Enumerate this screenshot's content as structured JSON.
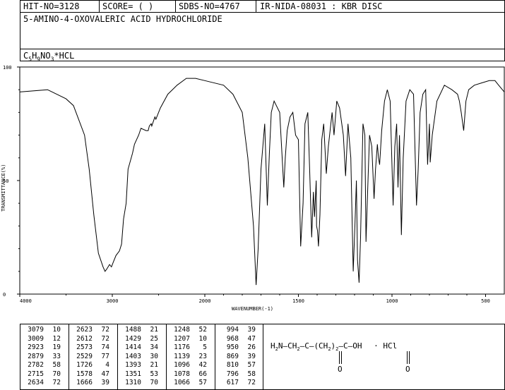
{
  "header": {
    "hit_no": "HIT-NO=3128",
    "score": "SCORE=  (   )",
    "sdbs_no": "SDBS-NO=4767",
    "ir_source": "IR-NIDA-08031 : KBR DISC",
    "compound_name": "5-AMINO-4-OXOVALERIC ACID HYDROCHLORIDE",
    "formula": "C5H9NO3*HCL"
  },
  "chart_data": {
    "type": "line",
    "xlabel": "WAVENUMBER(-1)",
    "ylabel": "TRANSMITTANCE(%)",
    "xlim": [
      4000,
      400
    ],
    "ylim": [
      0,
      100
    ],
    "x_ticks": [
      "4000",
      "3000",
      "2000",
      "1500",
      "1000",
      "500"
    ],
    "y_ticks": [
      "100",
      "50",
      "0"
    ],
    "series": [
      {
        "x": [
          4000,
          3700,
          3500,
          3420,
          3300,
          3250,
          3200,
          3150,
          3100,
          3079,
          3060,
          3030,
          3009,
          2990,
          2960,
          2923,
          2900,
          2879,
          2850,
          2830,
          2782,
          2760,
          2715,
          2690,
          2634,
          2623,
          2612,
          2600,
          2580,
          2573,
          2540,
          2529,
          2480,
          2400,
          2300,
          2200,
          2100,
          2000,
          1900,
          1850,
          1800,
          1770,
          1740,
          1726,
          1715,
          1700,
          1680,
          1666,
          1655,
          1645,
          1630,
          1600,
          1578,
          1570,
          1560,
          1545,
          1530,
          1515,
          1500,
          1488,
          1475,
          1465,
          1450,
          1440,
          1429,
          1420,
          1414,
          1405,
          1403,
          1398,
          1393,
          1385,
          1375,
          1365,
          1351,
          1340,
          1320,
          1310,
          1295,
          1280,
          1260,
          1248,
          1235,
          1220,
          1207,
          1198,
          1190,
          1184,
          1176,
          1168,
          1155,
          1145,
          1139,
          1130,
          1120,
          1108,
          1096,
          1088,
          1078,
          1072,
          1066,
          1055,
          1040,
          1025,
          1010,
          994,
          985,
          975,
          968,
          960,
          950,
          940,
          925,
          905,
          885,
          869,
          860,
          850,
          835,
          820,
          810,
          800,
          796,
          785,
          760,
          720,
          680,
          650,
          640,
          630,
          617,
          605,
          590,
          560,
          520,
          480,
          450,
          430,
          400
        ],
        "y": [
          89,
          90,
          86,
          83,
          70,
          55,
          35,
          18,
          12,
          10,
          11,
          13,
          12,
          14,
          17,
          19,
          22,
          33,
          40,
          55,
          62,
          66,
          70,
          73,
          72,
          72,
          72,
          74,
          75,
          74,
          78,
          77,
          82,
          88,
          92,
          95,
          95,
          94,
          92,
          88,
          80,
          60,
          30,
          4,
          20,
          55,
          75,
          39,
          62,
          80,
          85,
          80,
          47,
          60,
          72,
          78,
          80,
          70,
          68,
          21,
          40,
          75,
          80,
          55,
          25,
          45,
          34,
          50,
          30,
          28,
          21,
          35,
          68,
          75,
          53,
          65,
          80,
          70,
          85,
          82,
          70,
          52,
          75,
          60,
          10,
          30,
          50,
          15,
          5,
          25,
          75,
          70,
          23,
          45,
          70,
          65,
          42,
          55,
          66,
          60,
          57,
          72,
          85,
          90,
          85,
          39,
          65,
          75,
          47,
          70,
          26,
          60,
          85,
          90,
          88,
          39,
          55,
          80,
          88,
          90,
          57,
          75,
          58,
          70,
          85,
          92,
          90,
          88,
          85,
          80,
          72,
          85,
          90,
          92,
          93,
          94,
          94,
          92,
          89
        ]
      }
    ]
  },
  "peaks_table": {
    "columns": [
      [
        [
          "3079",
          "10"
        ],
        [
          "3009",
          "12"
        ],
        [
          "2923",
          "19"
        ],
        [
          "2879",
          "33"
        ],
        [
          "2782",
          "58"
        ],
        [
          "2715",
          "70"
        ],
        [
          "2634",
          "72"
        ]
      ],
      [
        [
          "2623",
          "72"
        ],
        [
          "2612",
          "72"
        ],
        [
          "2573",
          "74"
        ],
        [
          "2529",
          "77"
        ],
        [
          "1726",
          "4"
        ],
        [
          "1578",
          "47"
        ],
        [
          "1666",
          "39"
        ]
      ],
      [
        [
          "1488",
          "21"
        ],
        [
          "1429",
          "25"
        ],
        [
          "1414",
          "34"
        ],
        [
          "1403",
          "30"
        ],
        [
          "1393",
          "21"
        ],
        [
          "1351",
          "53"
        ],
        [
          "1310",
          "70"
        ]
      ],
      [
        [
          "1248",
          "52"
        ],
        [
          "1207",
          "10"
        ],
        [
          "1176",
          "5"
        ],
        [
          "1139",
          "23"
        ],
        [
          "1096",
          "42"
        ],
        [
          "1078",
          "66"
        ],
        [
          "1066",
          "57"
        ]
      ],
      [
        [
          "994",
          "39"
        ],
        [
          "968",
          "47"
        ],
        [
          "950",
          "26"
        ],
        [
          "869",
          "39"
        ],
        [
          "810",
          "57"
        ],
        [
          "796",
          "58"
        ],
        [
          "617",
          "72"
        ]
      ]
    ]
  },
  "structure": {
    "left": "H2N—CH2—C—(CH2)2—C—OH",
    "parts": [
      "H",
      "2",
      "N",
      "CH",
      "2",
      "C",
      "(CH",
      "2",
      ")",
      "2",
      "C",
      "OH",
      "· HCl",
      "O",
      "O"
    ]
  }
}
